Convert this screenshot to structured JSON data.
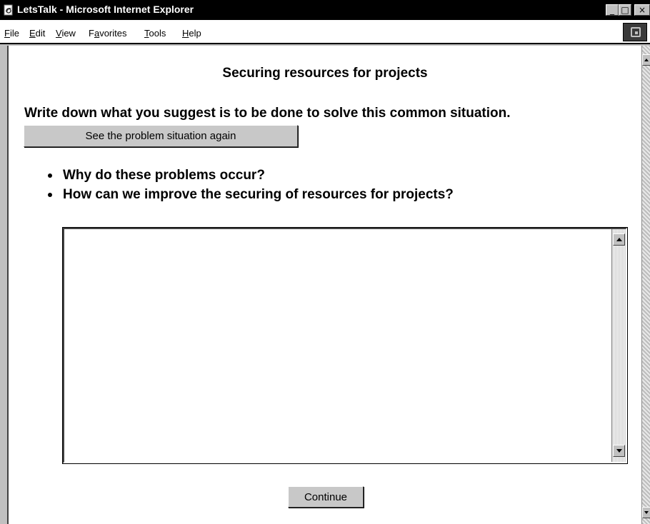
{
  "window": {
    "title": "LetsTalk - Microsoft Internet Explorer",
    "controls": {
      "minimize": "_",
      "maximize": "□",
      "close": "×"
    }
  },
  "menu": {
    "file": {
      "key": "F",
      "rest": "ile"
    },
    "edit": {
      "key": "E",
      "rest": "dit"
    },
    "view": {
      "key": "V",
      "rest": "iew"
    },
    "favorites": {
      "pre": "F",
      "key": "a",
      "rest": "vorites"
    },
    "tools": {
      "key": "T",
      "rest": "ools"
    },
    "help": {
      "key": "H",
      "rest": "elp"
    }
  },
  "page": {
    "title": "Securing resources for projects",
    "instruction": "Write down what you suggest is to be done to solve this common situation.",
    "problem_button": "See the problem situation again",
    "questions": [
      "Why do these problems occur?",
      "How can we improve the securing of resources for projects?"
    ],
    "answer_value": "",
    "continue_button": "Continue"
  },
  "icons": {
    "app": "ie-page-icon",
    "throbber": "windows-logo-icon"
  },
  "colors": {
    "titlebar": "#000000",
    "chrome": "#c0c0c0",
    "page_background": "#ffffff"
  }
}
